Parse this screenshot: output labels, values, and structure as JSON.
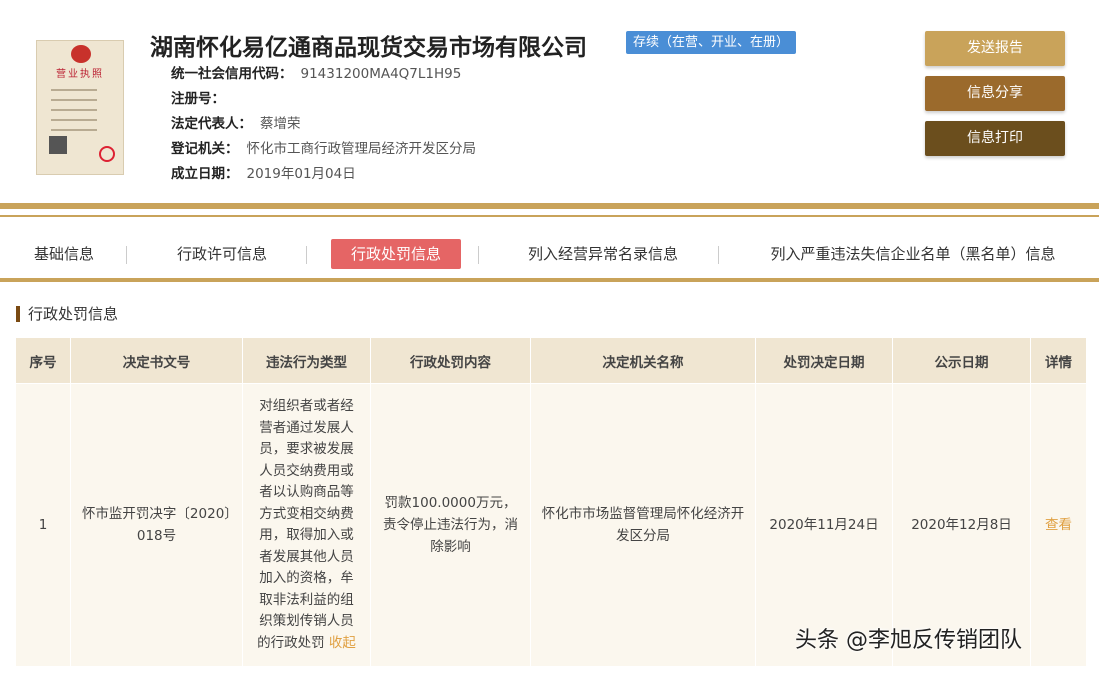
{
  "header": {
    "license_title": "营业执照",
    "company_name": "湖南怀化易亿通商品现货交易市场有限公司",
    "status": "存续（在营、开业、在册）",
    "fields": [
      {
        "label": "统一社会信用代码：",
        "value": "91431200MA4Q7L1H95"
      },
      {
        "label": "注册号：",
        "value": ""
      },
      {
        "label": "法定代表人：",
        "value": "蔡增荣"
      },
      {
        "label": "登记机关：",
        "value": "怀化市工商行政管理局经济开发区分局"
      },
      {
        "label": "成立日期：",
        "value": "2019年01月04日"
      }
    ],
    "buttons": {
      "report": "发送报告",
      "share": "信息分享",
      "print": "信息打印"
    }
  },
  "tabs": [
    "基础信息",
    "行政许可信息",
    "行政处罚信息",
    "列入经营异常名录信息",
    "列入严重违法失信企业名单（黑名单）信息"
  ],
  "active_tab": "行政处罚信息",
  "section": {
    "title": "行政处罚信息"
  },
  "table": {
    "columns": [
      "序号",
      "决定书文号",
      "违法行为类型",
      "行政处罚内容",
      "决定机关名称",
      "处罚决定日期",
      "公示日期",
      "详情"
    ],
    "rows": [
      {
        "index": "1",
        "doc_no": "怀市监开罚决字〔2020〕018号",
        "violation": "对组织者或者经营者通过发展人员，要求被发展人员交纳费用或者以认购商品等方式变相交纳费用，取得加入或者发展其他人员加入的资格，牟取非法利益的组织策划传销人员的行政处罚",
        "collapse": "收起",
        "penalty": "罚款100.0000万元，责令停止违法行为，消除影响",
        "authority": "怀化市市场监督管理局怀化经济开发区分局",
        "decision_date": "2020年11月24日",
        "publish_date": "2020年12月8日",
        "detail": "查看"
      }
    ]
  },
  "watermark": "头条 @李旭反传销团队",
  "colors": {
    "gold": "#c9a35a",
    "brown": "#9b6a2c",
    "dark_brown": "#6b4e1d",
    "active_tab": "#e56565",
    "badge": "#4a8ed6",
    "link": "#e0a042"
  }
}
